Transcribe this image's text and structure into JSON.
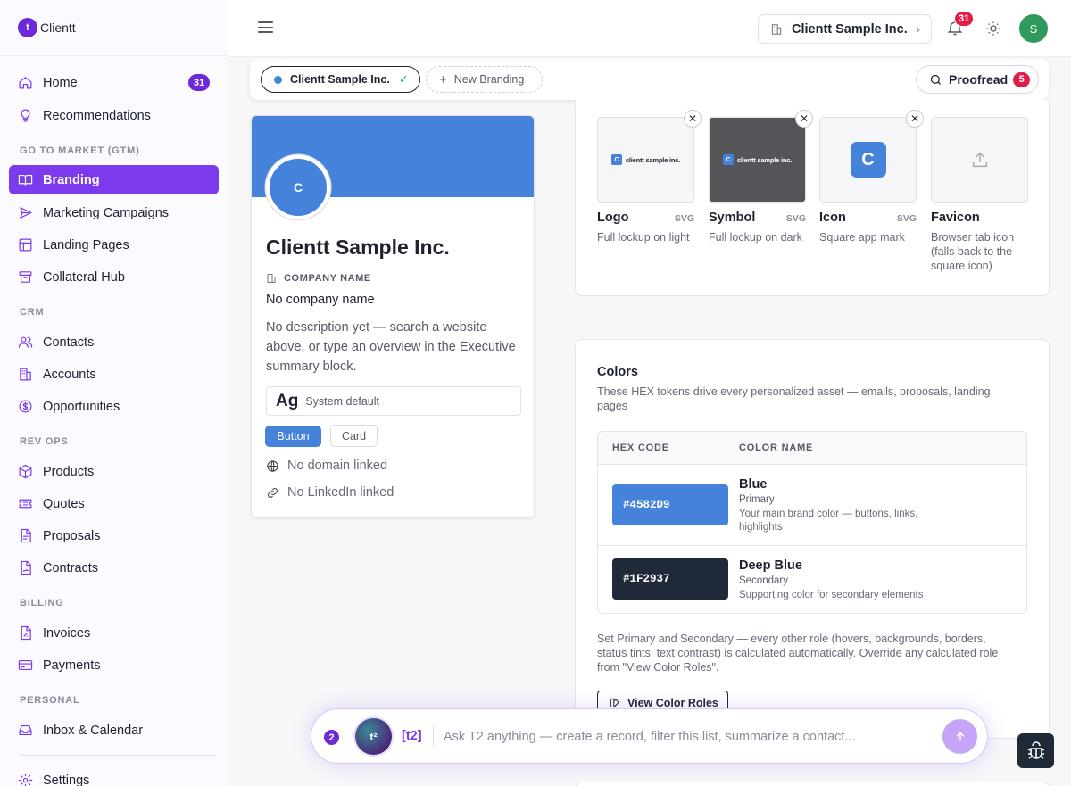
{
  "app": {
    "name": "Clientt",
    "logo_letter": "t"
  },
  "sidebar": {
    "items": [
      {
        "label": "Home",
        "icon": "home-icon",
        "badge": "31"
      },
      {
        "label": "Recommendations",
        "icon": "lightbulb-icon"
      },
      {
        "label": "Branding",
        "icon": "book-icon",
        "active": true
      },
      {
        "label": "Marketing Campaigns",
        "icon": "send-icon"
      },
      {
        "label": "Landing Pages",
        "icon": "layout-icon"
      },
      {
        "label": "Collateral Hub",
        "icon": "archive-icon"
      },
      {
        "label": "Contacts",
        "icon": "users-icon"
      },
      {
        "label": "Accounts",
        "icon": "building-icon"
      },
      {
        "label": "Opportunities",
        "icon": "dollar-icon"
      },
      {
        "label": "Products",
        "icon": "box-icon"
      },
      {
        "label": "Quotes",
        "icon": "ticket-icon"
      },
      {
        "label": "Proposals",
        "icon": "file-icon"
      },
      {
        "label": "Contracts",
        "icon": "file-contract-icon"
      },
      {
        "label": "Invoices",
        "icon": "invoice-icon"
      },
      {
        "label": "Payments",
        "icon": "credit-card-icon"
      },
      {
        "label": "Inbox & Calendar",
        "icon": "inbox-icon"
      },
      {
        "label": "Settings",
        "icon": "gear-icon"
      }
    ],
    "sections": [
      "GO TO MARKET (GTM)",
      "CRM",
      "REV OPS",
      "BILLING",
      "PERSONAL"
    ]
  },
  "topbar": {
    "org_name": "Clientt Sample Inc.",
    "notifications": "31",
    "user_initial": "S"
  },
  "tabs": {
    "active_label": "Clientt Sample Inc.",
    "new_label": "New Branding",
    "proofread_label": "Proofread",
    "proofread_count": "5"
  },
  "profile": {
    "avatar_letter": "C",
    "title": "Clientt Sample Inc.",
    "company_label": "COMPANY NAME",
    "company_value": "No company name",
    "description": "No description yet — search a website above, or type an overview in the Executive summary block.",
    "font_sample": "Ag",
    "font_name": "System default",
    "button_sample": "Button",
    "card_sample": "Card",
    "domain": "No domain linked",
    "linkedin": "No LinkedIn linked"
  },
  "assets": [
    {
      "name": "Logo",
      "format": "SVG",
      "desc": "Full lockup on light",
      "lockup_text": "clientt sample inc.",
      "lockup_letter": "C"
    },
    {
      "name": "Symbol",
      "format": "SVG",
      "desc": "Full lockup on dark",
      "lockup_text": "clientt sample inc.",
      "lockup_letter": "C"
    },
    {
      "name": "Icon",
      "format": "SVG",
      "desc": "Square app mark",
      "mark": "C"
    },
    {
      "name": "Favicon",
      "format": "",
      "desc": "Browser tab icon (falls back to the square icon)"
    }
  ],
  "colors": {
    "title": "Colors",
    "subtitle": "These HEX tokens drive every personalized asset — emails, proposals, landing pages",
    "col_hex": "HEX CODE",
    "col_name": "COLOR NAME",
    "rows": [
      {
        "hex": "#4582D9",
        "name": "Blue",
        "role": "Primary",
        "desc": "Your main brand color — buttons, links, highlights"
      },
      {
        "hex": "#1F2937",
        "name": "Deep Blue",
        "role": "Secondary",
        "desc": "Supporting color for secondary elements"
      }
    ],
    "note": "Set Primary and Secondary — every other role (hovers, backgrounds, borders, status tints, text contrast) is calculated automatically. Override any calculated role from \"View Color Roles\".",
    "view_roles_label": "View Color Roles"
  },
  "ai": {
    "count": "2",
    "avatar_text": "t²",
    "tag": "[t2]",
    "placeholder": "Ask T2 anything — create a record, filter this list, summarize a contact..."
  },
  "theme": {
    "accent": "#7c3aed",
    "brand_primary": "#4582D9",
    "brand_secondary": "#1F2937",
    "alert": "#e11d48"
  }
}
